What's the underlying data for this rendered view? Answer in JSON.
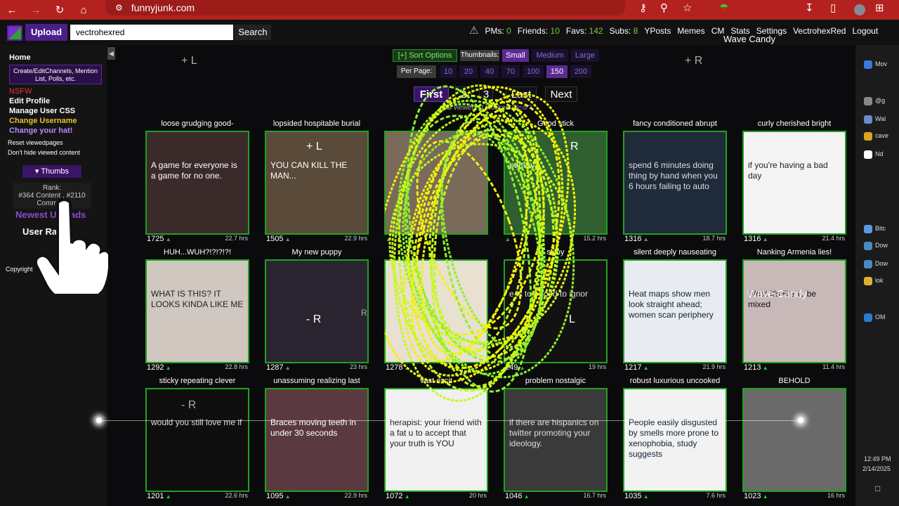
{
  "browser": {
    "url": "funnyjunk.com",
    "overlay_text": "Wave Candy"
  },
  "site": {
    "upload_label": "Upload",
    "search_value": "vectrohexred",
    "search_label": "Search",
    "nav": [
      {
        "label": "PMs:",
        "value": "0"
      },
      {
        "label": "Friends:",
        "value": "10"
      },
      {
        "label": "Favs:",
        "value": "142"
      },
      {
        "label": "Subs:",
        "value": "8"
      },
      {
        "label": "YPosts",
        "value": ""
      },
      {
        "label": "Memes",
        "value": ""
      },
      {
        "label": "CM",
        "value": ""
      },
      {
        "label": "Stats",
        "value": ""
      },
      {
        "label": "Settings",
        "value": ""
      },
      {
        "label": "VectrohexRed",
        "value": ""
      },
      {
        "label": "Logout",
        "value": ""
      }
    ]
  },
  "sidebar": {
    "home": "Home",
    "create_channels": "Create/EditChannels, Mention List, Polls, etc.",
    "nsfw": "NSFW",
    "edit_profile": "Edit Profile",
    "manage_css": "Manage User CSS",
    "change_username": "Change Username",
    "change_hat": "Change your hat!",
    "reset_viewed": "Reset viewedpages",
    "dont_hide": "Don't hide viewed content",
    "thumbs": "Thumbs",
    "rank_label": "Rank:",
    "rank_content": "#364 Content",
    "rank_comment": "#2110",
    "rank_comment_label": "Comment",
    "newest_uploads": "Newest Uploads",
    "user_rank": "User Ra",
    "copyright": "Copyright"
  },
  "controls": {
    "sort_options": "[+] Sort Options",
    "thumbnails_label": "Thumbnails:",
    "sizes": [
      "Small",
      "Medium",
      "Large"
    ],
    "active_size": "Small",
    "per_page_label": "Per Page:",
    "per_page": [
      "10",
      "20",
      "40",
      "70",
      "100",
      "150",
      "200"
    ],
    "active_per_page": "150",
    "status_text": "63 viewed, 0 blocked",
    "clear_label": "Clear?"
  },
  "pager": {
    "first": "First",
    "page2": "2",
    "page3": "3",
    "last": "Last",
    "next": "Next"
  },
  "overlay_markers": [
    "+ L",
    "+ R",
    "+ L",
    "R",
    "- R",
    "R",
    "- R",
    "L"
  ],
  "thumbs": [
    {
      "title": "loose grudging good-",
      "votes": "1725",
      "time": "22.7 hrs",
      "caption": "A game for everyone is a game for no one."
    },
    {
      "title": "lopsided hospitable burial",
      "votes": "1505",
      "time": "22.9 hrs",
      "caption": "YOU CAN KILL THE MAN..."
    },
    {
      "title": "",
      "votes": "",
      "time": "",
      "caption": ""
    },
    {
      "title": "Good stick",
      "votes": "",
      "time": "15.2 hrs",
      "caption": "pottery"
    },
    {
      "title": "fancy conditioned abrupt",
      "votes": "1316",
      "time": "18.7 hrs",
      "caption": "spend 6 minutes doing thing by hand when you 6 hours failing to auto"
    },
    {
      "title": "curly cherished bright",
      "votes": "1316",
      "time": "21.4 hrs",
      "caption": "if you're having a bad day"
    },
    {
      "title": "HUH...WUH?!?!?!?!",
      "votes": "1292",
      "time": "22.8 hrs",
      "caption": "WHAT IS THIS? IT LOOKS KINDA LIKE ME"
    },
    {
      "title": "My new puppy",
      "votes": "1287",
      "time": "23 hrs",
      "caption": ""
    },
    {
      "title": "",
      "votes": "1278",
      "time": "",
      "caption": ""
    },
    {
      "title": "slimy",
      "votes": "249",
      "time": "19 hrs",
      "caption": "e is too good to ignor"
    },
    {
      "title": "silent deeply nauseating",
      "votes": "1217",
      "time": "21.9 hrs",
      "caption": "Heat maps show men look straight ahead; women scan periphery"
    },
    {
      "title": "Nanking Armenia lies!",
      "votes": "1213",
      "time": "11.4 hrs",
      "caption": "What it's like to be mixed"
    },
    {
      "title": "sticky repeating clever",
      "votes": "1201",
      "time": "22.6 hrs",
      "caption": "would you still love me if"
    },
    {
      "title": "unassuming realizing last",
      "votes": "1095",
      "time": "22.9 hrs",
      "caption": "Braces moving teeth in under 30 seconds"
    },
    {
      "title": "vast excit",
      "votes": "1072",
      "time": "20 hrs",
      "caption": "herapist: your friend with a fat u to accept that your truth is YOU"
    },
    {
      "title": "problem nostalgic",
      "votes": "1046",
      "time": "16.7 hrs",
      "caption": "if there are hispanics on twitter promoting your ideology."
    },
    {
      "title": "robust luxurious uncooked",
      "votes": "1035",
      "time": "7.6 hrs",
      "caption": "People easily disgusted by smells more prone to xenophobia, study suggests"
    },
    {
      "title": "BEHOLD",
      "votes": "1023",
      "time": "16 hrs",
      "caption": ""
    }
  ],
  "dock": {
    "items": [
      "Mov",
      "@g",
      "Wal",
      "cave",
      "Nd",
      "Bitc",
      "Dow",
      "Dow",
      "lok",
      "OM"
    ],
    "time": "12:49 PM",
    "date": "2/14/2025"
  }
}
